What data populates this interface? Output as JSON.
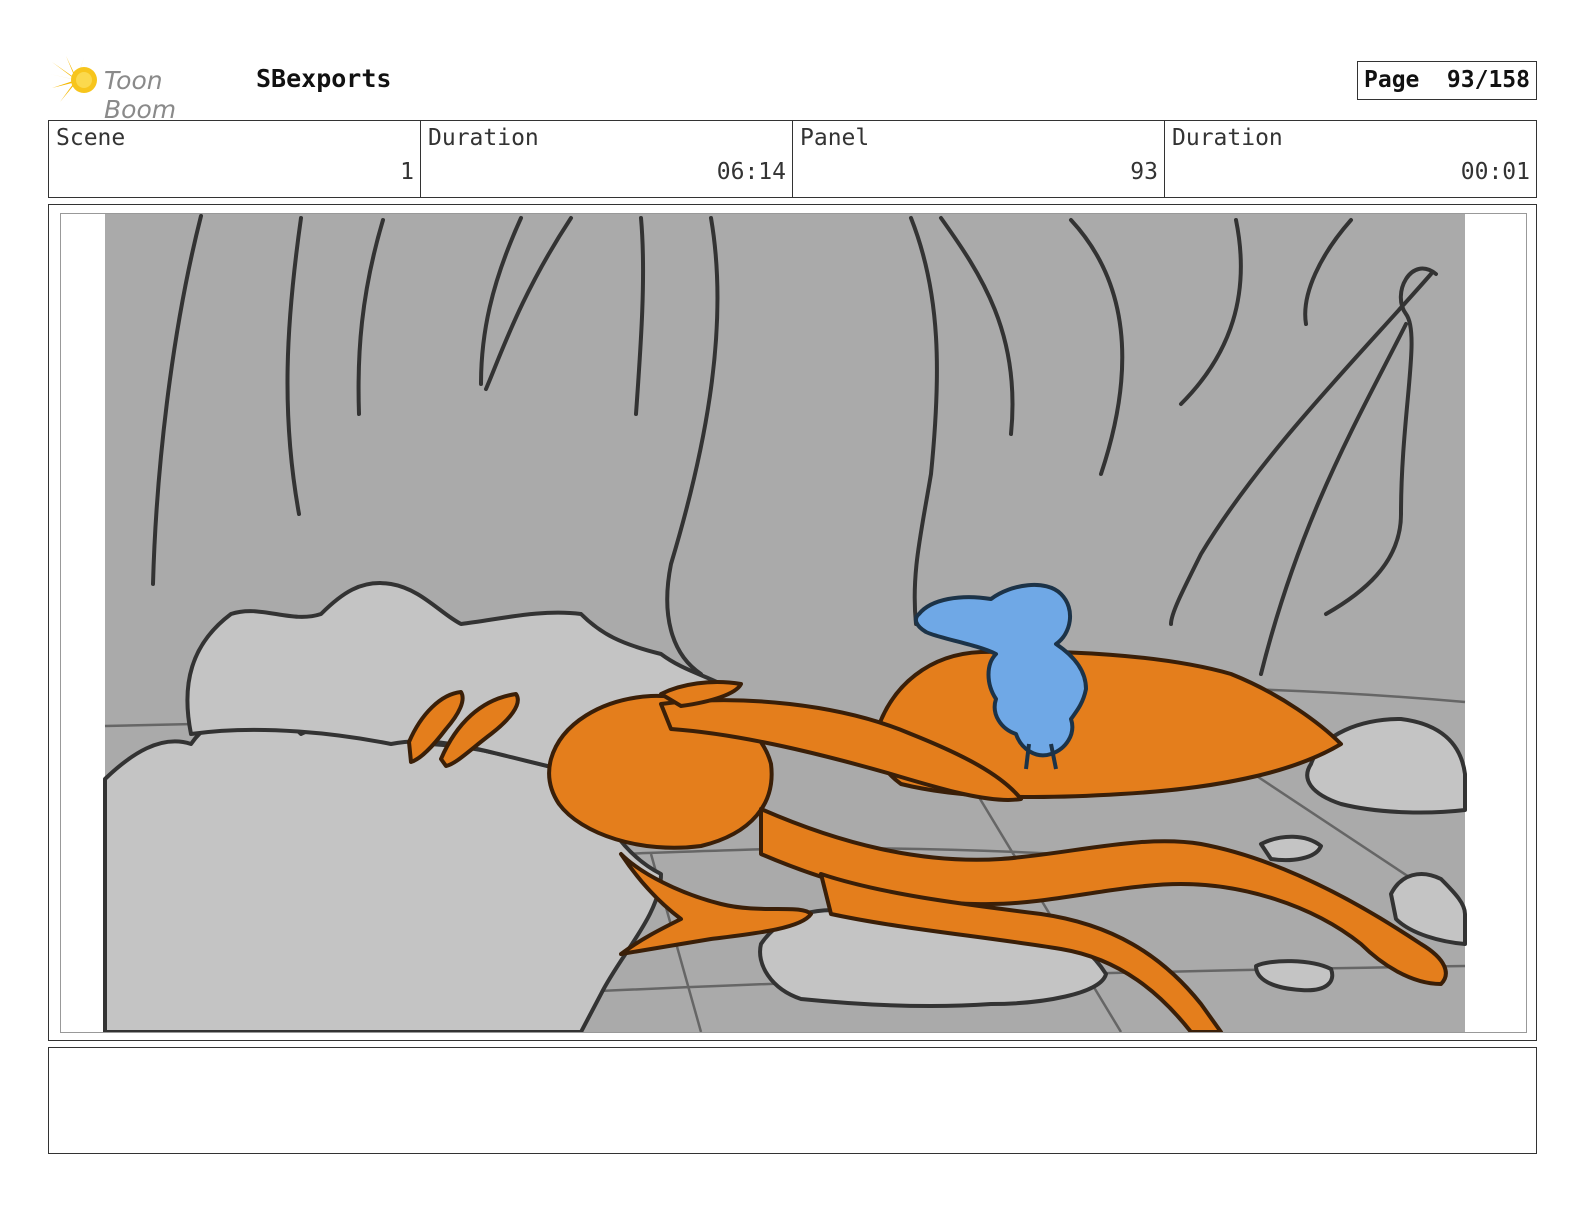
{
  "header": {
    "logo_text": "Toon Boom",
    "project_name": "SBexports",
    "page_label": "Page",
    "page_value": "93/158"
  },
  "info": {
    "scene_label": "Scene",
    "scene_value": "1",
    "scene_duration_label": "Duration",
    "scene_duration_value": "06:14",
    "panel_label": "Panel",
    "panel_value": "93",
    "panel_duration_label": "Duration",
    "panel_duration_value": "00:01"
  },
  "panel": {
    "image_icon": "storyboard-sketch",
    "colors": {
      "background": "#aaaaaa",
      "rocks": "#c4c4c4",
      "orange_character": "#e47e1c",
      "blue_character": "#6fa8e6",
      "line": "#333333"
    }
  },
  "notes": {
    "text": ""
  }
}
